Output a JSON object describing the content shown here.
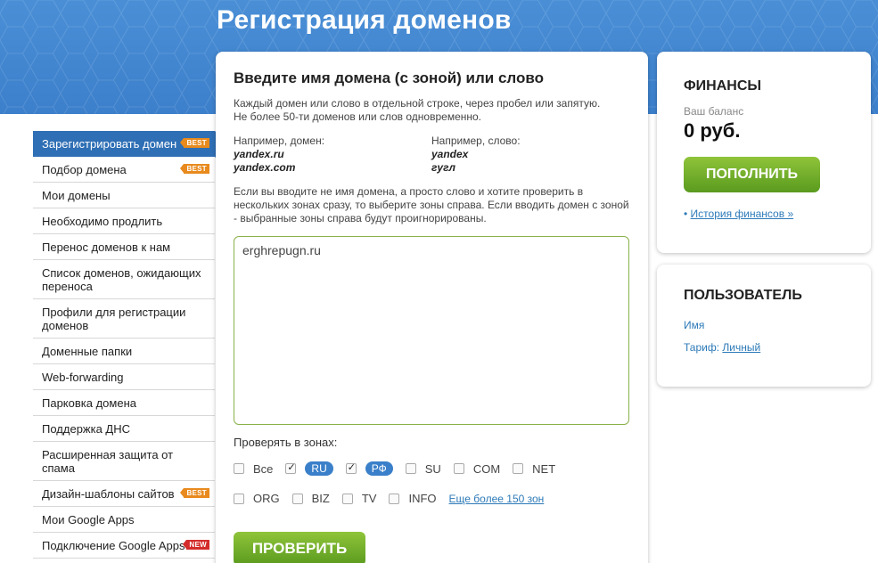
{
  "page": {
    "title": "Регистрация доменов"
  },
  "sidebar": {
    "items": [
      {
        "label": "Зарегистрировать домен",
        "badge": "BEST",
        "active": true
      },
      {
        "label": "Подбор домена",
        "badge": "BEST"
      },
      {
        "label": "Мои домены"
      },
      {
        "label": "Необходимо продлить"
      },
      {
        "label": "Перенос доменов к нам"
      },
      {
        "label": "Список доменов, ожидающих переноса"
      },
      {
        "label": "Профили для регистрации доменов"
      },
      {
        "label": "Доменные папки"
      },
      {
        "label": "Web-forwarding"
      },
      {
        "label": "Парковка домена"
      },
      {
        "label": "Поддержка ДНС"
      },
      {
        "label": "Расширенная защита от спама"
      },
      {
        "label": "Дизайн-шаблоны сайтов",
        "badge": "BEST"
      },
      {
        "label": "Мои Google Apps"
      },
      {
        "label": "Подключение Google Apps",
        "badge": "NEW"
      }
    ]
  },
  "main": {
    "heading": "Введите имя домена (с зоной) или слово",
    "desc_line1": "Каждый домен или слово в отдельной строке, через пробел или запятую.",
    "desc_line2": "Не более 50-ти доменов или слов одновременно.",
    "example_domain_label": "Например, домен:",
    "example_domain_1": "yandex.ru",
    "example_domain_2": "yandex.com",
    "example_word_label": "Например, слово:",
    "example_word_1": "yandex",
    "example_word_2": "гугл",
    "desc2": "Если вы вводите не имя домена, а просто слово и хотите проверить в нескольких зонах сразу, то выберите зоны справа. Если вводить домен с зоной - выбранные зоны справа будут проигнорированы.",
    "domain_input_value": "erghrepugn.ru",
    "zones_label": "Проверять в зонах:",
    "zones_row1": [
      {
        "label": "Все",
        "checked": false
      },
      {
        "label": "RU",
        "checked": true
      },
      {
        "label": "РФ",
        "checked": true
      },
      {
        "label": "SU",
        "checked": false
      },
      {
        "label": "COM",
        "checked": false
      },
      {
        "label": "NET",
        "checked": false
      }
    ],
    "zones_row2": [
      {
        "label": "ORG",
        "checked": false
      },
      {
        "label": "BIZ",
        "checked": false
      },
      {
        "label": "TV",
        "checked": false
      },
      {
        "label": "INFO",
        "checked": false
      }
    ],
    "more_zones_link": "Еще более 150 зон",
    "check_button": "ПРОВЕРИТЬ"
  },
  "finance": {
    "heading": "ФИНАНСЫ",
    "balance_label": "Ваш баланс",
    "balance_value": "0 руб.",
    "topup_button": "ПОПОЛНИТЬ",
    "history_prefix": "• ",
    "history_link": "История финансов »"
  },
  "user": {
    "heading": "ПОЛЬЗОВАТЕЛЬ",
    "name_label": "Имя",
    "tariff_label": "Тариф:",
    "tariff_value": "Личный"
  },
  "colors": {
    "accent_blue": "#2f6fb5",
    "green_button": "#6aab26",
    "link": "#2d7ab8"
  }
}
